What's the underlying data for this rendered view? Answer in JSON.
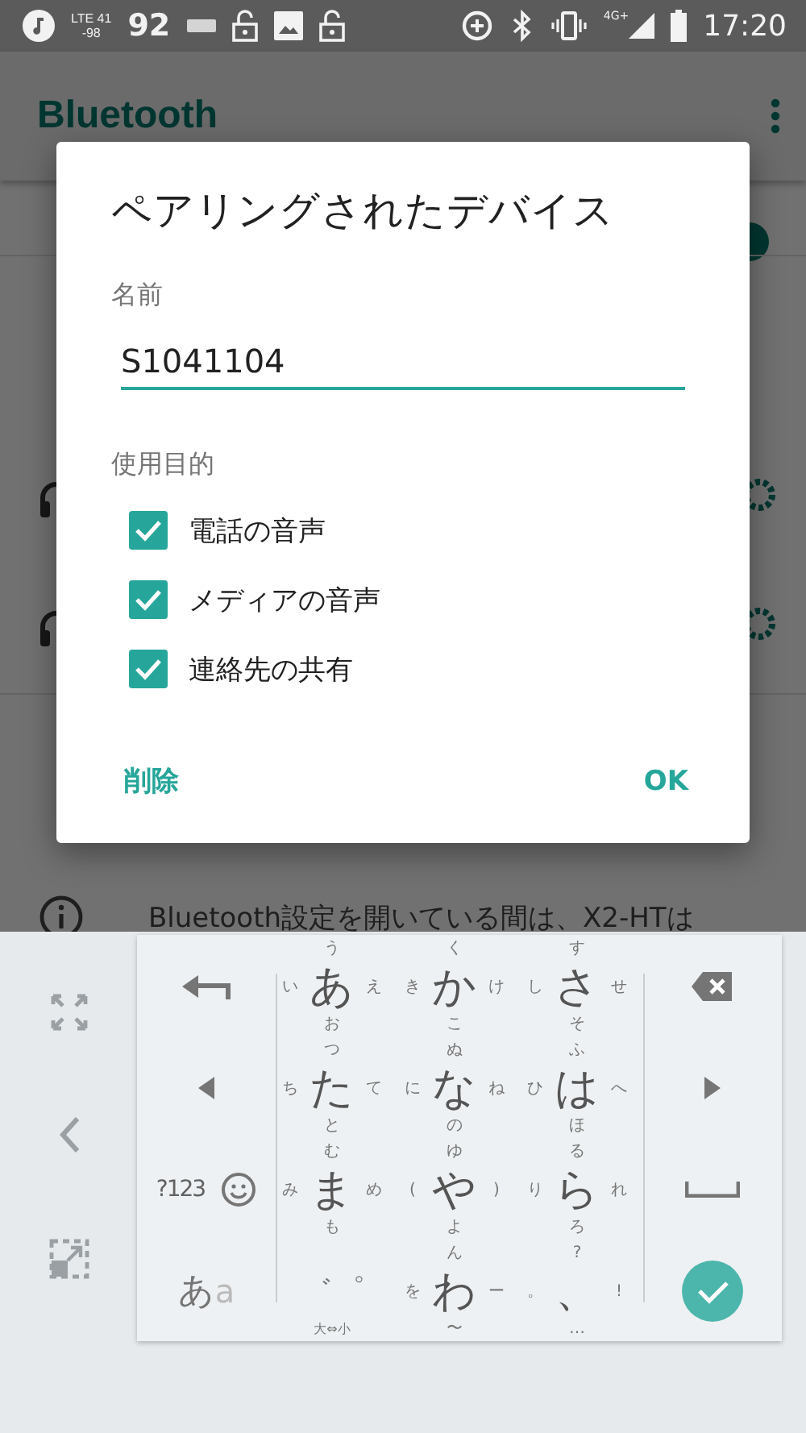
{
  "status_bar": {
    "lte_label": "LTE 41",
    "signal_reading": "-98",
    "count": "92",
    "network": "4G+",
    "time": "17:20"
  },
  "app_bar": {
    "title": "Bluetooth"
  },
  "background": {
    "switch_on": true,
    "info_text": "Bluetooth設定を開いている間は、X2-HTは"
  },
  "dialog": {
    "title": "ペアリングされたデバイス",
    "name_label": "名前",
    "name_value": "S1041104",
    "purpose_label": "使用目的",
    "options": [
      {
        "label": "電話の音声",
        "checked": true
      },
      {
        "label": "メディアの音声",
        "checked": true
      },
      {
        "label": "連絡先の共有",
        "checked": true
      }
    ],
    "buttons": [
      "削除",
      "OK"
    ]
  },
  "keyboard": {
    "mode_key": "?123",
    "kana_toggle": {
      "main": "あ",
      "sub": "a"
    },
    "kana_rows": [
      [
        {
          "main": "あ",
          "up": "う",
          "left": "い",
          "right": "え",
          "down": "お"
        },
        {
          "main": "か",
          "up": "く",
          "left": "き",
          "right": "け",
          "down": "こ"
        },
        {
          "main": "さ",
          "up": "す",
          "left": "し",
          "right": "せ",
          "down": "そ"
        }
      ],
      [
        {
          "main": "た",
          "up": "つ",
          "left": "ち",
          "right": "て",
          "down": "と"
        },
        {
          "main": "な",
          "up": "ぬ",
          "left": "に",
          "right": "ね",
          "down": "の"
        },
        {
          "main": "は",
          "up": "ふ",
          "left": "ひ",
          "right": "へ",
          "down": "ほ"
        }
      ],
      [
        {
          "main": "ま",
          "up": "む",
          "left": "み",
          "right": "め",
          "down": "も"
        },
        {
          "main": "や",
          "up": "ゆ",
          "left": "(",
          "right": ")",
          "down": "よ"
        },
        {
          "main": "ら",
          "up": "る",
          "left": "り",
          "right": "れ",
          "down": "ろ"
        }
      ],
      [
        {
          "main": "゛゜",
          "down": "大⇔小"
        },
        {
          "main": "わ",
          "up": "ん",
          "left": "を",
          "right": "ー",
          "down": "〜"
        },
        {
          "main": "、",
          "up": "?",
          "left": "。",
          "right": "!",
          "down": "…"
        }
      ]
    ]
  }
}
